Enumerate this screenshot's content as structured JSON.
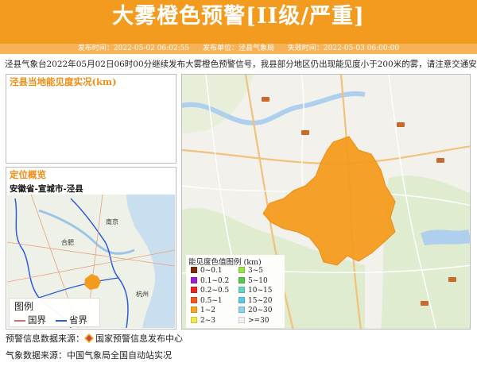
{
  "header": {
    "title": "大雾橙色预警[II级/严重]",
    "publish_time_label": "发布时间：",
    "publish_time": "2022-05-02 06:02:55",
    "publisher_label": "发布单位：",
    "publisher": "泾县气象局",
    "expire_label": "失效时间：",
    "expire_time": "2022-05-03 06:00:00"
  },
  "notice": "泾县气象台2022年05月02日06时00分继续发布大雾橙色预警信号，我县部分地区仍出现能见度小于200米的雾，请注意交通安全。",
  "visibility_panel": {
    "title": "泾县当地能见度实况(km)"
  },
  "location_panel": {
    "title": "定位概览",
    "region": "安徽省-宣城市-泾县",
    "map_labels": [
      "南京",
      "合肥",
      "杭州"
    ],
    "legend_title": "图例",
    "legend_items": [
      {
        "label": "国界",
        "color": "#d96b6b"
      },
      {
        "label": "省界",
        "color": "#2c5bd8"
      }
    ]
  },
  "main_map": {
    "legend_title": "能见度色值图例 (km)",
    "legend_items": [
      {
        "label": "0~0.1",
        "color": "#7a2d0a"
      },
      {
        "label": "0.1~0.2",
        "color": "#9b1ed8"
      },
      {
        "label": "0.2~0.5",
        "color": "#e8251f"
      },
      {
        "label": "0.5~1",
        "color": "#f25a1c"
      },
      {
        "label": "1~2",
        "color": "#f5a623"
      },
      {
        "label": "2~3",
        "color": "#f2e94a"
      },
      {
        "label": "3~5",
        "color": "#9ee04c"
      },
      {
        "label": "5~10",
        "color": "#52c94e"
      },
      {
        "label": "10~15",
        "color": "#5fd6c1"
      },
      {
        "label": "15~20",
        "color": "#5ec8e6"
      },
      {
        "label": "20~30",
        "color": "#8fd0ee"
      },
      {
        "label": ">=30",
        "color": "#f2f2f2"
      }
    ],
    "warning_area_color": "#f39b1f"
  },
  "sources": {
    "warning_source_label": "预警信息数据来源：",
    "warning_source": "国家预警信息发布中心",
    "weather_source_label": "气象数据来源：",
    "weather_source": "中国气象局全国自动站实况"
  },
  "colors": {
    "header_bg": "#f39b1f",
    "accent": "#f08c12"
  }
}
